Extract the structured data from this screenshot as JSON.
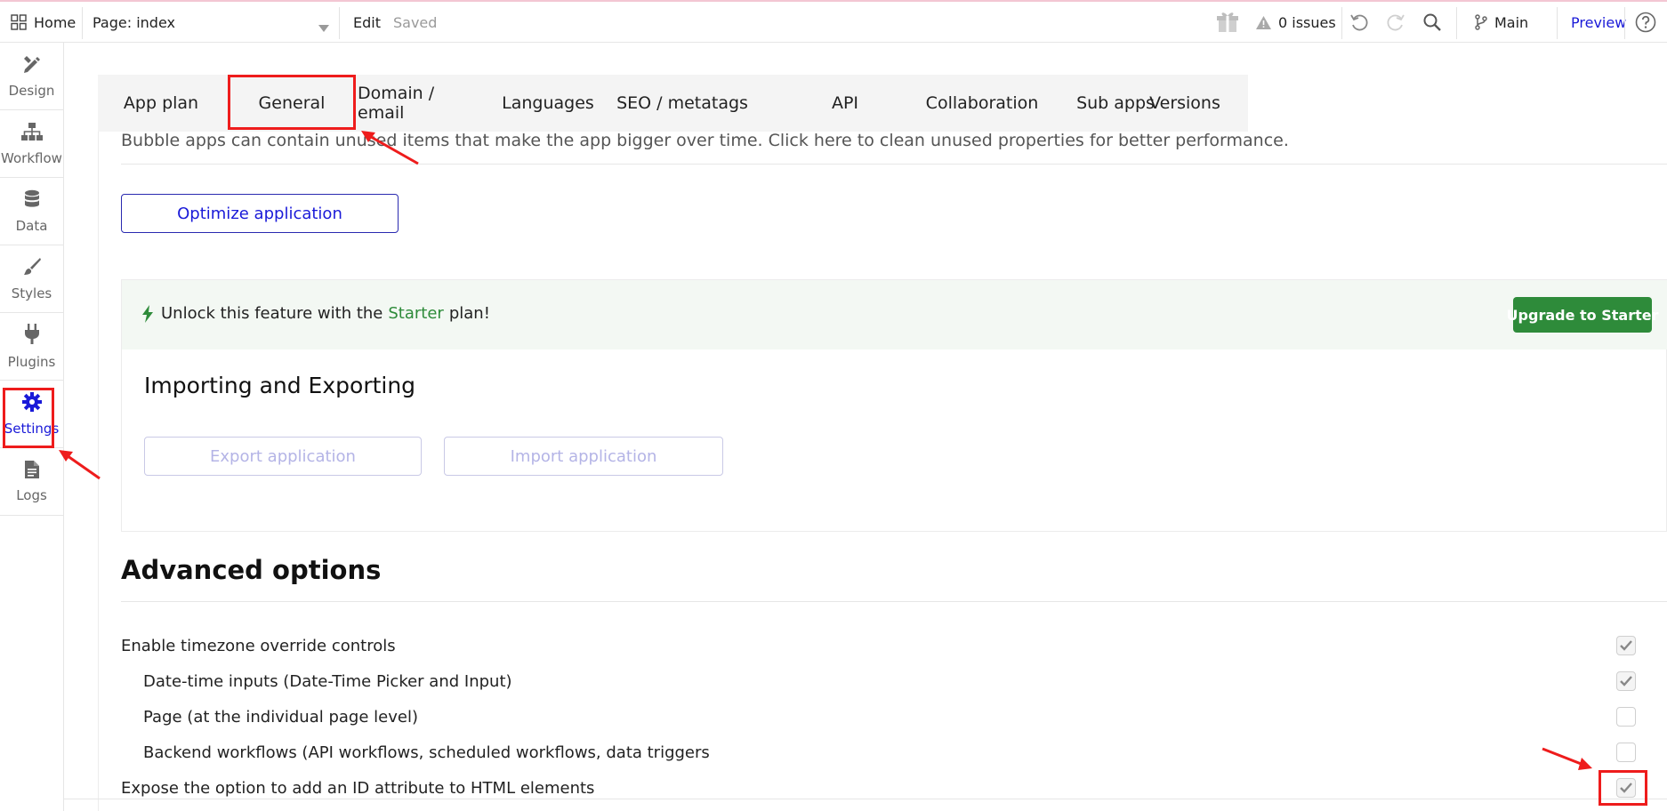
{
  "topbar": {
    "home_label": "Home",
    "page_select": "Page: index",
    "edit_label": "Edit",
    "saved_label": "Saved",
    "issues_label": "0 issues",
    "branch_label": "Main",
    "preview_label": "Preview"
  },
  "sidebar": {
    "items": [
      {
        "label": "Design"
      },
      {
        "label": "Workflow"
      },
      {
        "label": "Data"
      },
      {
        "label": "Styles"
      },
      {
        "label": "Plugins"
      },
      {
        "label": "Settings"
      },
      {
        "label": "Logs"
      }
    ]
  },
  "tabs": [
    "App plan",
    "General",
    "Domain / email",
    "Languages",
    "SEO / metatags",
    "API",
    "Collaboration",
    "Sub apps",
    "Versions"
  ],
  "active_tab": "General",
  "optimize": {
    "description": "Bubble apps can contain unused items that make the app bigger over time. Click here to clean unused properties for better performance.",
    "button_label": "Optimize application"
  },
  "upgrade_banner": {
    "text_before": "Unlock this feature with the",
    "plan_name": "Starter",
    "text_after": "plan!",
    "button_label": "Upgrade to Starter"
  },
  "import_export": {
    "title": "Importing and Exporting",
    "export_label": "Export application",
    "import_label": "Import application"
  },
  "advanced": {
    "title": "Advanced options",
    "options": [
      {
        "label": "Enable timezone override controls",
        "checked": true
      },
      {
        "label": "Date-time inputs (Date-Time Picker and Input)",
        "checked": true
      },
      {
        "label": "Page (at the individual page level)",
        "checked": false
      },
      {
        "label": "Backend workflows (API workflows, scheduled workflows, data triggers",
        "checked": false
      },
      {
        "label": "Expose the option to add an ID attribute to HTML elements",
        "checked": true
      }
    ]
  },
  "colors": {
    "accent_blue": "#1a1ad8",
    "green": "#2e8b3a",
    "annotation_red": "#ee1c1c"
  }
}
